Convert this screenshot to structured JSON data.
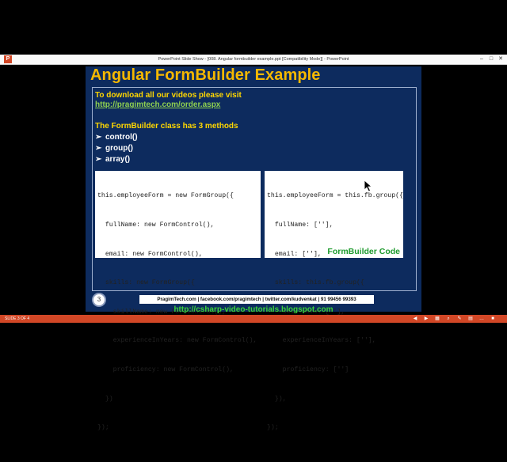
{
  "window": {
    "title": "PowerPoint Slide Show - [008. Angular formbuilder example.ppt [Compatibility Mode]] - PowerPoint",
    "app_icon_glyph": "P",
    "controls": [
      "–",
      "□",
      "✕"
    ]
  },
  "slide": {
    "title": "Angular FormBuilder Example",
    "download_text": "To download all our videos please visit",
    "download_link": "http://pragimtech.com/order.aspx",
    "formbuilder_intro": "The FormBuilder class has 3 methods",
    "methods": [
      "control()",
      "group()",
      "array()"
    ],
    "code_left": [
      "this.employeeForm = new FormGroup({",
      "  fullName: new FormControl(),",
      "  email: new FormControl(),",
      "  skills: new FormGroup({",
      "    skillName: new FormControl(),",
      "    experienceInYears: new FormControl(),",
      "    proficiency: new FormControl(),",
      "  })",
      "});"
    ],
    "code_right": [
      "this.employeeForm = this.fb.group({",
      "  fullName: [''],",
      "  email: [''],",
      "  skills: this.fb.group({",
      "    skillName: [''],",
      "    experienceInYears: [''],",
      "    proficiency: ['']",
      "  }),",
      "});"
    ],
    "code_caption": "FormBuilder Code",
    "slide_number": "3",
    "contact_bar": "PragimTech.com | facebook.com/pragimtech | twitter.com/kudvenkat | 91 99456 99393"
  },
  "blog_link": "http://csharp-video-tutorials.blogspot.com",
  "statusbar": {
    "slide_counter": "SLIDE 3 OF 4"
  },
  "colors": {
    "slide_bg": "#0d2b5e",
    "title": "#f5b800",
    "link_green": "#8fd14f",
    "status_bar": "#d24726"
  }
}
